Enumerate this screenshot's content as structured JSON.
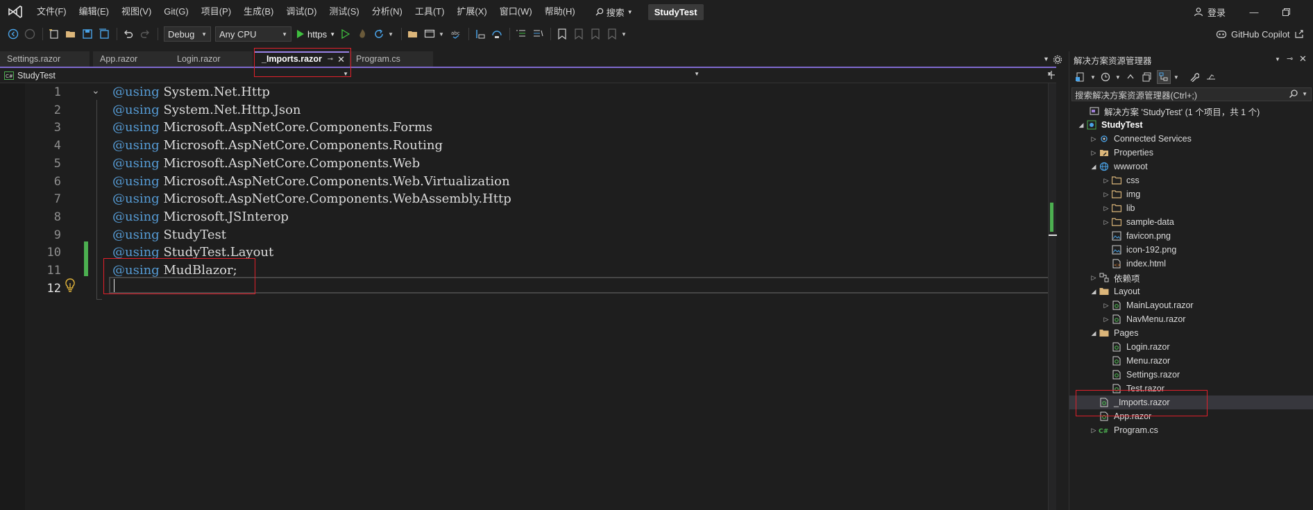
{
  "menu": {
    "items": [
      "文件(F)",
      "编辑(E)",
      "视图(V)",
      "Git(G)",
      "项目(P)",
      "生成(B)",
      "调试(D)",
      "测试(S)",
      "分析(N)",
      "工具(T)",
      "扩展(X)",
      "窗口(W)",
      "帮助(H)"
    ],
    "search_label": "搜索",
    "solution_name": "StudyTest",
    "login_label": "登录"
  },
  "toolbar": {
    "config": "Debug",
    "platform": "Any CPU",
    "run_profile": "https",
    "copilot_label": "GitHub Copilot"
  },
  "tabs": [
    {
      "label": "Settings.razor",
      "active": false
    },
    {
      "label": "App.razor",
      "active": false
    },
    {
      "label": "Login.razor",
      "active": false
    },
    {
      "label": "_Imports.razor",
      "active": true
    },
    {
      "label": "Program.cs",
      "active": false
    }
  ],
  "navbar": {
    "project": "StudyTest"
  },
  "editor": {
    "keyword": "using",
    "at": "@",
    "lines": [
      {
        "num": "1",
        "text": "System.Net.Http"
      },
      {
        "num": "2",
        "text": "System.Net.Http.Json"
      },
      {
        "num": "3",
        "text": "Microsoft.AspNetCore.Components.Forms"
      },
      {
        "num": "4",
        "text": "Microsoft.AspNetCore.Components.Routing"
      },
      {
        "num": "5",
        "text": "Microsoft.AspNetCore.Components.Web"
      },
      {
        "num": "6",
        "text": "Microsoft.AspNetCore.Components.Web.Virtualization"
      },
      {
        "num": "7",
        "text": "Microsoft.AspNetCore.Components.WebAssembly.Http"
      },
      {
        "num": "8",
        "text": "Microsoft.JSInterop"
      },
      {
        "num": "9",
        "text": "StudyTest"
      },
      {
        "num": "10",
        "text": "StudyTest.Layout"
      },
      {
        "num": "11",
        "text": "MudBlazor;"
      },
      {
        "num": "12",
        "text": ""
      }
    ]
  },
  "solution_explorer": {
    "title": "解决方案资源管理器",
    "search_placeholder": "搜索解决方案资源管理器(Ctrl+;)",
    "tree": [
      {
        "label": "解决方案 'StudyTest' (1 个项目，共 1 个)",
        "icon": "solution-icon"
      },
      {
        "label": "StudyTest",
        "icon": "project-icon"
      },
      {
        "label": "Connected Services",
        "icon": "connected-services-icon"
      },
      {
        "label": "Properties",
        "icon": "properties-icon"
      },
      {
        "label": "wwwroot",
        "icon": "globe-icon"
      },
      {
        "label": "css",
        "icon": "folder-icon"
      },
      {
        "label": "img",
        "icon": "folder-icon"
      },
      {
        "label": "lib",
        "icon": "folder-icon"
      },
      {
        "label": "sample-data",
        "icon": "folder-icon"
      },
      {
        "label": "favicon.png",
        "icon": "image-file-icon"
      },
      {
        "label": "icon-192.png",
        "icon": "image-file-icon"
      },
      {
        "label": "index.html",
        "icon": "html-file-icon"
      },
      {
        "label": "依赖项",
        "icon": "dependencies-icon"
      },
      {
        "label": "Layout",
        "icon": "folder-icon"
      },
      {
        "label": "MainLayout.razor",
        "icon": "razor-file-icon"
      },
      {
        "label": "NavMenu.razor",
        "icon": "razor-file-icon"
      },
      {
        "label": "Pages",
        "icon": "folder-icon"
      },
      {
        "label": "Login.razor",
        "icon": "razor-file-icon"
      },
      {
        "label": "Menu.razor",
        "icon": "razor-file-icon"
      },
      {
        "label": "Settings.razor",
        "icon": "razor-file-icon"
      },
      {
        "label": "Test.razor",
        "icon": "razor-file-icon"
      },
      {
        "label": "_Imports.razor",
        "icon": "razor-file-icon"
      },
      {
        "label": "App.razor",
        "icon": "razor-file-icon"
      },
      {
        "label": "Program.cs",
        "icon": "csharp-file-icon"
      }
    ]
  },
  "colors": {
    "accent": "#9b83e8",
    "keyword": "#569cd6",
    "change_bar": "#4caf50",
    "highlight_box": "#e3202b"
  }
}
